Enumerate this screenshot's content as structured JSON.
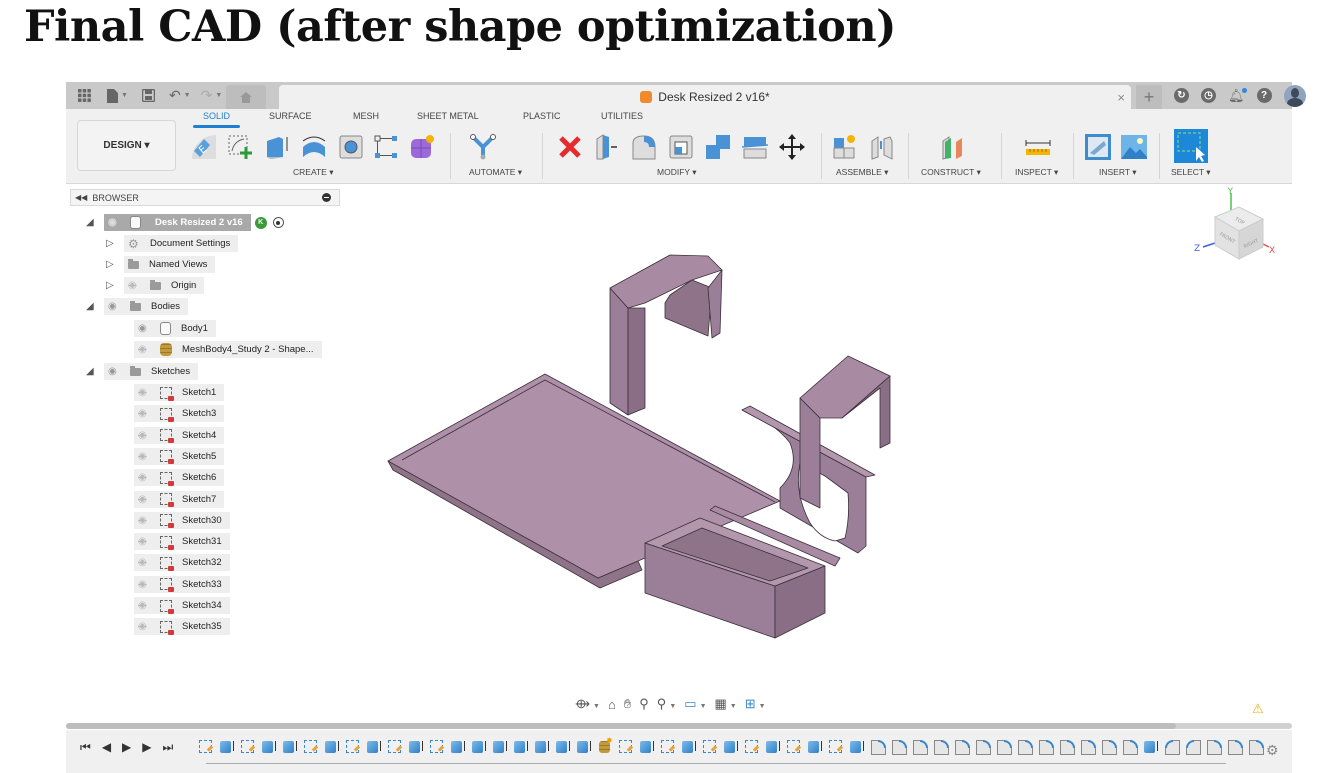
{
  "slide": {
    "title": "Final CAD (after shape optimization)"
  },
  "titlebar": {
    "document_title": "Desk Resized 2 v16*",
    "icons": [
      "apps-grid-icon",
      "file-icon",
      "save-icon",
      "undo-icon",
      "redo-icon",
      "home-icon"
    ],
    "right_icons": [
      "new-tab-plus-icon",
      "extensions-icon",
      "job-status-icon",
      "notifications-icon",
      "help-icon",
      "user-avatar"
    ]
  },
  "toolbar": {
    "workspace": "DESIGN ▾",
    "tabs": [
      {
        "label": "SOLID",
        "active": true
      },
      {
        "label": "SURFACE",
        "active": false
      },
      {
        "label": "MESH",
        "active": false
      },
      {
        "label": "SHEET METAL",
        "active": false
      },
      {
        "label": "PLASTIC",
        "active": false
      },
      {
        "label": "UTILITIES",
        "active": false
      }
    ],
    "groups": [
      {
        "label": "CREATE ▾",
        "tools": [
          "create-sketch",
          "create-sketch-plus",
          "extrude",
          "revolve",
          "hole",
          "rectangular-pattern",
          "create-form"
        ]
      },
      {
        "label": "AUTOMATE ▾",
        "tools": [
          "automate"
        ]
      },
      {
        "label": "MODIFY ▾",
        "tools": [
          "delete",
          "press-pull",
          "fillet",
          "shell",
          "combine",
          "split-body",
          "move-copy"
        ]
      },
      {
        "label": "ASSEMBLE ▾",
        "tools": [
          "new-component",
          "joint"
        ]
      },
      {
        "label": "CONSTRUCT ▾",
        "tools": [
          "offset-plane"
        ]
      },
      {
        "label": "INSPECT ▾",
        "tools": [
          "measure"
        ]
      },
      {
        "label": "INSERT ▾",
        "tools": [
          "insert-decal",
          "insert-canvas"
        ]
      },
      {
        "label": "SELECT ▾",
        "tools": [
          "select"
        ]
      }
    ]
  },
  "browser": {
    "header": "BROWSER",
    "root": {
      "label": "Desk Resized 2 v16",
      "badge": "K"
    },
    "items": [
      {
        "label": "Document Settings",
        "type": "settings",
        "expand": "closed"
      },
      {
        "label": "Named Views",
        "type": "folder",
        "expand": "closed"
      },
      {
        "label": "Origin",
        "type": "folder",
        "expand": "closed",
        "visible": false
      },
      {
        "label": "Bodies",
        "type": "folder",
        "expand": "open",
        "visible": true
      },
      {
        "label": "Body1",
        "type": "body",
        "visible": true
      },
      {
        "label": "MeshBody4_Study 2 - Shape...",
        "type": "mesh",
        "visible": false
      },
      {
        "label": "Sketches",
        "type": "folder",
        "expand": "open",
        "visible": true
      }
    ],
    "sketches": [
      "Sketch1",
      "Sketch3",
      "Sketch4",
      "Sketch5",
      "Sketch6",
      "Sketch7",
      "Sketch30",
      "Sketch31",
      "Sketch32",
      "Sketch33",
      "Sketch34",
      "Sketch35"
    ]
  },
  "viewcube": {
    "faces": [
      "TOP",
      "FRONT",
      "RIGHT"
    ],
    "axes": [
      "Y",
      "Z",
      "X"
    ],
    "axis_colors": {
      "x": "#e05050",
      "y": "#50c050",
      "z": "#4060e0"
    }
  },
  "model": {
    "color": "#a98aa3",
    "edge_color": "#3b2f3a"
  },
  "navbar": {
    "icons": [
      "orbit-icon",
      "look-at-icon",
      "pan-icon",
      "zoom-icon",
      "fit-icon",
      "display-settings-icon",
      "grid-icon",
      "viewports-icon"
    ]
  },
  "timeline": {
    "controls": [
      "⏮",
      "◀",
      "▶",
      "▶",
      "⏭"
    ],
    "features": [
      "sketch",
      "extrude",
      "sketch",
      "extrude",
      "extrude",
      "sketch",
      "extrude",
      "sketch",
      "extrude",
      "sketch",
      "extrude",
      "sketch",
      "extrude",
      "extrude",
      "extrude",
      "extrude",
      "extrude",
      "extrude",
      "extrude",
      "mesh",
      "sketch",
      "extrude",
      "sketch",
      "extrude",
      "sketch",
      "extrude",
      "sketch",
      "extrude",
      "sketch",
      "extrude",
      "sketch",
      "extrude",
      "fillet",
      "fillet",
      "fillet",
      "fillet",
      "fillet",
      "fillet",
      "fillet",
      "fillet",
      "fillet",
      "fillet",
      "fillet",
      "fillet",
      "fillet",
      "extrude",
      "chamfer",
      "chamfer",
      "fillet",
      "fillet",
      "fillet"
    ]
  },
  "status": {
    "warning": "⚠"
  }
}
